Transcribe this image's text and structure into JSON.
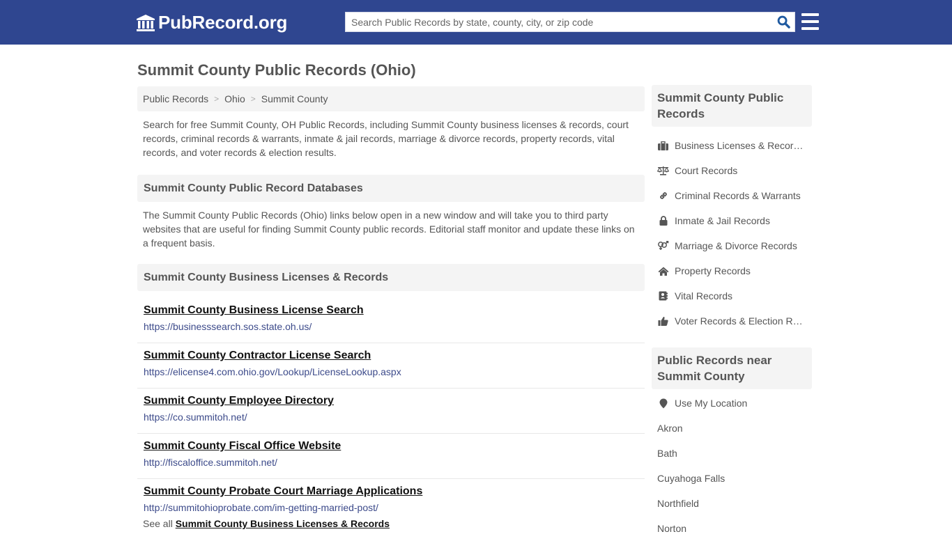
{
  "header": {
    "logo_text": "PubRecord.org",
    "search_placeholder": "Search Public Records by state, county, city, or zip code",
    "search_value": "",
    "brand_color": "#2f4690"
  },
  "page": {
    "title": "Summit County Public Records (Ohio)",
    "breadcrumb": [
      "Public Records",
      "Ohio",
      "Summit County"
    ],
    "intro": "Search for free Summit County, OH Public Records, including Summit County business licenses & records, court records, criminal records & warrants, inmate & jail records, marriage & divorce records, property records, vital records, and voter records & election results.",
    "databases_heading": "Summit County Public Record Databases",
    "databases_text": "The Summit County Public Records (Ohio) links below open in a new window and will take you to third party websites that are useful for finding Summit County public records. Editorial staff monitor and update these links on a frequent basis.",
    "business_heading": "Summit County Business Licenses & Records",
    "links": [
      {
        "title": "Summit County Business License Search",
        "url": "https://businesssearch.sos.state.oh.us/"
      },
      {
        "title": "Summit County Contractor License Search",
        "url": "https://elicense4.com.ohio.gov/Lookup/LicenseLookup.aspx"
      },
      {
        "title": "Summit County Employee Directory",
        "url": "https://co.summitoh.net/"
      },
      {
        "title": "Summit County Fiscal Office Website",
        "url": "http://fiscaloffice.summitoh.net/"
      },
      {
        "title": "Summit County Probate Court Marriage Applications",
        "url": "http://summitohioprobate.com/im-getting-married-post/"
      }
    ],
    "see_all_prefix": "See all",
    "see_all_link": "Summit County Business Licenses & Records"
  },
  "sidebar": {
    "records_heading": "Summit County Public Records",
    "records": [
      {
        "icon": "briefcase-icon",
        "label": "Business Licenses & Records"
      },
      {
        "icon": "balance-scale-icon",
        "label": "Court Records"
      },
      {
        "icon": "link-icon",
        "label": "Criminal Records & Warrants"
      },
      {
        "icon": "lock-icon",
        "label": "Inmate & Jail Records"
      },
      {
        "icon": "venus-mars-icon",
        "label": "Marriage & Divorce Records"
      },
      {
        "icon": "home-icon",
        "label": "Property Records"
      },
      {
        "icon": "address-book-icon",
        "label": "Vital Records"
      },
      {
        "icon": "thumbs-up-icon",
        "label": "Voter Records & Election Results"
      }
    ],
    "near_heading": "Public Records near Summit County",
    "use_location": "Use My Location",
    "places": [
      "Akron",
      "Bath",
      "Cuyahoga Falls",
      "Northfield",
      "Norton"
    ]
  }
}
